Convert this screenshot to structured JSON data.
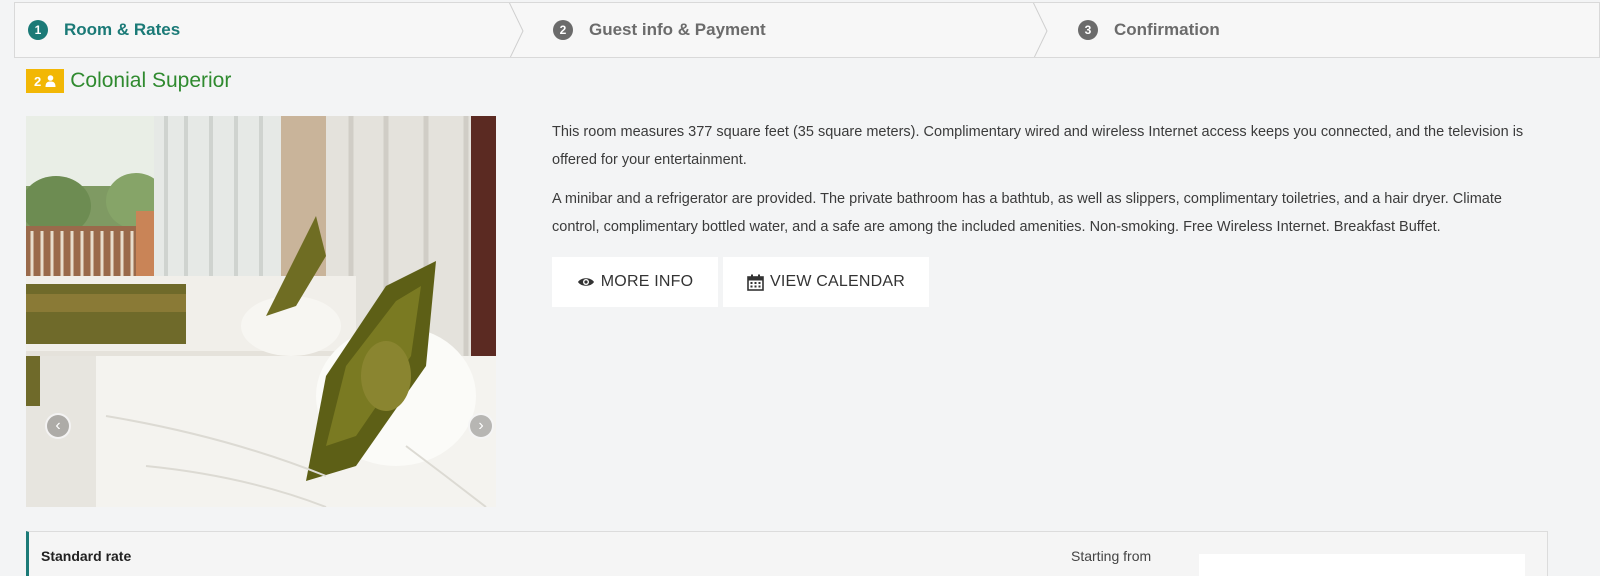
{
  "stepper": {
    "steps": [
      {
        "number": "1",
        "label": "Room & Rates",
        "state": "active"
      },
      {
        "number": "2",
        "label": "Guest info & Payment",
        "state": "inactive"
      },
      {
        "number": "3",
        "label": "Confirmation",
        "state": "inactive"
      }
    ]
  },
  "room": {
    "guest_count": "2",
    "guest_icon": "person-icon",
    "name": "Colonial Superior",
    "carousel": {
      "prev_glyph": "‹",
      "next_glyph": "›"
    },
    "description": [
      "This room measures 377 square feet (35 square meters). Complimentary wired and wireless Internet access keeps you connected, and the television is offered for your entertainment.",
      "A minibar and a refrigerator are provided. The private bathroom has a bathtub, as well as slippers, complimentary toiletries, and a hair dryer. Climate control, complimentary bottled water, and a safe are among the included amenities. Non-smoking. Free Wireless Internet. Breakfast Buffet."
    ],
    "buttons": {
      "more_info": "MORE INFO",
      "view_calendar": "VIEW CALENDAR"
    }
  },
  "rate": {
    "name": "Standard rate",
    "starting_label": "Starting from"
  },
  "colors": {
    "accent_teal": "#1b7a77",
    "room_name_green": "#2f8a2f",
    "badge_yellow": "#f2b705",
    "inactive_grey": "#6b6b6b"
  }
}
